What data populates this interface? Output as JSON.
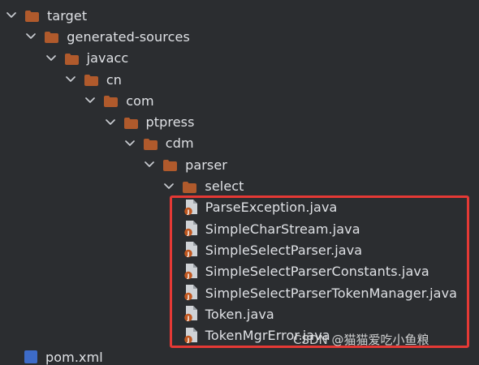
{
  "tree": [
    {
      "label": "target",
      "type": "folder",
      "depth": 0
    },
    {
      "label": "generated-sources",
      "type": "folder",
      "depth": 1
    },
    {
      "label": "javacc",
      "type": "folder",
      "depth": 2
    },
    {
      "label": "cn",
      "type": "folder",
      "depth": 3
    },
    {
      "label": "com",
      "type": "folder",
      "depth": 4
    },
    {
      "label": "ptpress",
      "type": "folder",
      "depth": 5
    },
    {
      "label": "cdm",
      "type": "folder",
      "depth": 6
    },
    {
      "label": "parser",
      "type": "folder",
      "depth": 7
    },
    {
      "label": "select",
      "type": "folder",
      "depth": 8
    },
    {
      "label": "ParseException.java",
      "type": "java",
      "depth": 9
    },
    {
      "label": "SimpleCharStream.java",
      "type": "java",
      "depth": 9
    },
    {
      "label": "SimpleSelectParser.java",
      "type": "java",
      "depth": 9
    },
    {
      "label": "SimpleSelectParserConstants.java",
      "type": "java",
      "depth": 9
    },
    {
      "label": "SimpleSelectParserTokenManager.java",
      "type": "java",
      "depth": 9
    },
    {
      "label": "Token.java",
      "type": "java",
      "depth": 9
    },
    {
      "label": "TokenMgrError.java",
      "type": "java",
      "depth": 9
    }
  ],
  "partial_item": {
    "label": "pom.xml",
    "icon": "xml-file-icon"
  },
  "watermark": "CSDN @猫猫爱吃小鱼粮",
  "colors": {
    "background": "#2b2d30",
    "folder": "#b05a2c",
    "text": "#dfe1e5",
    "highlight_border": "#e53935"
  },
  "icons": {
    "expanded": "chevron-down-icon",
    "folder": "folder-icon",
    "java": "java-file-icon"
  }
}
